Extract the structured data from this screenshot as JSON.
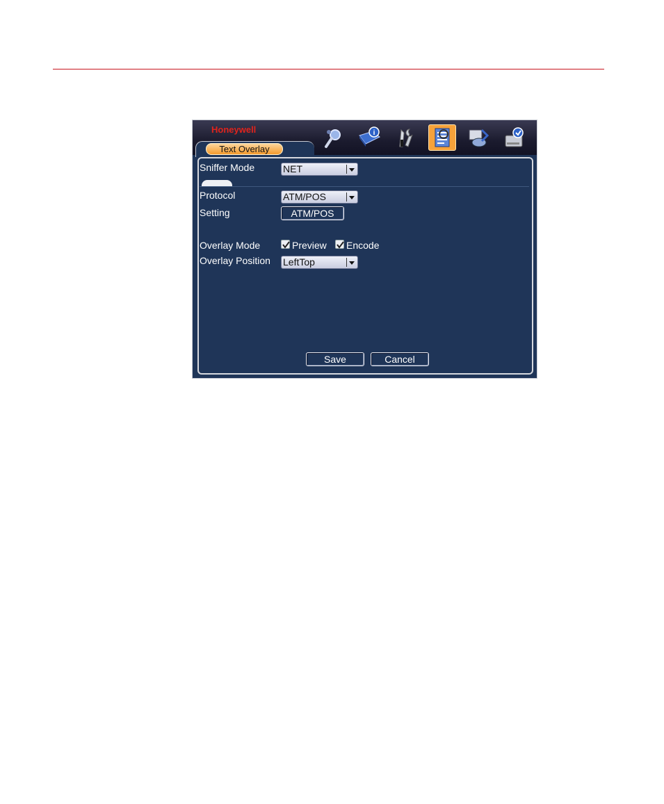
{
  "brand": "Honeywell",
  "tab": {
    "label": "Text Overlay"
  },
  "toolbar_icons": [
    "search-icon",
    "info-book-icon",
    "tools-icon",
    "text-overlay-icon",
    "backup-icon",
    "disk-icon"
  ],
  "form": {
    "sniffer_mode": {
      "label": "Sniffer Mode",
      "value": "NET"
    },
    "protocol": {
      "label": "Protocol",
      "value": "ATM/POS"
    },
    "setting": {
      "label": "Setting",
      "button": "ATM/POS"
    },
    "overlay_mode": {
      "label": "Overlay Mode",
      "preview": "Preview",
      "encode": "Encode"
    },
    "overlay_position": {
      "label": "Overlay Position",
      "value": "LeftTop"
    }
  },
  "buttons": {
    "save": "Save",
    "cancel": "Cancel"
  },
  "colors": {
    "accent": "#f49a2d",
    "background": "#1f3558",
    "brand": "#e0231c"
  }
}
